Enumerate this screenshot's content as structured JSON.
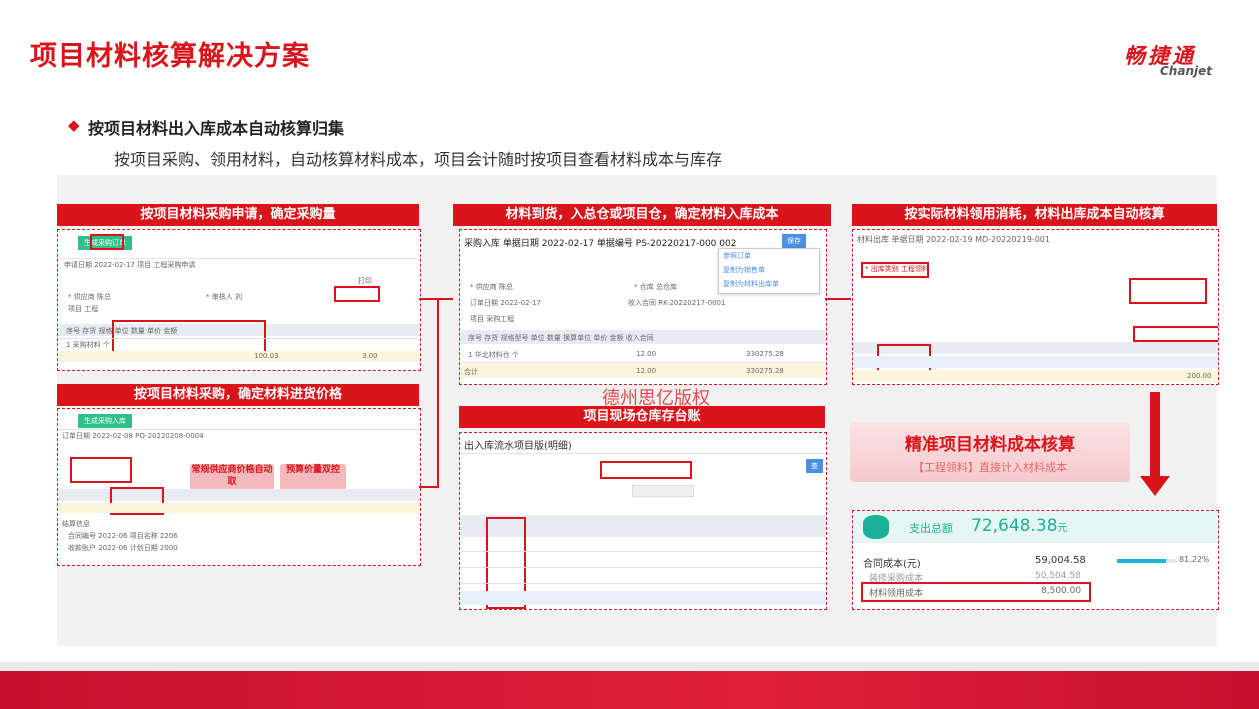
{
  "header": {
    "title": "项目材料核算解决方案",
    "brand_cn": "畅捷通",
    "brand_en": "Chanjet"
  },
  "intro": {
    "bullet": "◆",
    "heading": "按项目材料出入库成本自动核算归集",
    "description": "按项目采购、领用材料，自动核算材料成本，项目会计随时按项目查看材料成本与库存"
  },
  "panels": {
    "purchase_request": {
      "title": "按项目材料采购申请，确定采购量",
      "total_a": "100.03",
      "total_b": "3.00"
    },
    "purchase_price": {
      "title": "按项目材料采购，确定材料进货价格",
      "tag_supplier": "常规供应商价格自动取",
      "tag_budget": "预算价量双控"
    },
    "arrival": {
      "title": "材料到货，入总仓或项目仓，确定材料入库成本",
      "date": "2022-02-17",
      "code": "PS-20220217-000 002",
      "qty": "12.00",
      "amount": "330275.28",
      "menu": [
        "参照订单",
        "复制为销售单",
        "复制为材料出库单"
      ]
    },
    "stock_ledger": {
      "title": "项目现场仓库存台账",
      "sheet_title": "出入库流水项目版(明细)"
    },
    "material_out": {
      "title": "按实际材料领用消耗，材料出库成本自动核算",
      "date": "2022-02-19",
      "code": "MD-20220219-001",
      "total": "200.00",
      "tag": "工程领料"
    },
    "accurate": {
      "title": "精准项目材料成本核算",
      "subtitle": "【工程领料】直接计入材料成本"
    },
    "summary": {
      "label": "支出总额",
      "total": "72,648.38",
      "unit": "元",
      "rows": [
        {
          "label": "合同成本(元)",
          "value": "59,004.58",
          "percent": "81.22%"
        },
        {
          "label": "装修采购成本",
          "value": "50,504.58"
        },
        {
          "label": "材料领用成本",
          "value": "8,500.00"
        }
      ],
      "progress": 0.8122
    }
  },
  "watermark": "德州思亿版权",
  "colors": {
    "brand_red": "#d9141b",
    "accent_green": "#2ec08a",
    "accent_blue": "#4a8fe0",
    "teal": "#1ab09a"
  }
}
